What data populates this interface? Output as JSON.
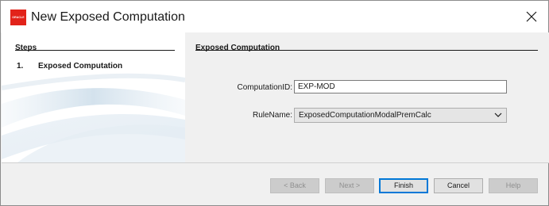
{
  "window": {
    "title": "New Exposed Computation",
    "logo_text": "ORACLE"
  },
  "steps": {
    "header": "Steps",
    "items": [
      {
        "number": "1.",
        "label": "Exposed Computation"
      }
    ]
  },
  "form": {
    "header": "Exposed Computation",
    "computation_id_label": "ComputationID:",
    "computation_id_value": "EXP-MOD",
    "rule_name_label": "RuleName:",
    "rule_name_value": "ExposedComputationModalPremCalc"
  },
  "buttons": {
    "back": "< Back",
    "next": "Next >",
    "finish": "Finish",
    "cancel": "Cancel",
    "help": "Help"
  },
  "colors": {
    "brand": "#e2231a",
    "accent": "#0078d7"
  }
}
